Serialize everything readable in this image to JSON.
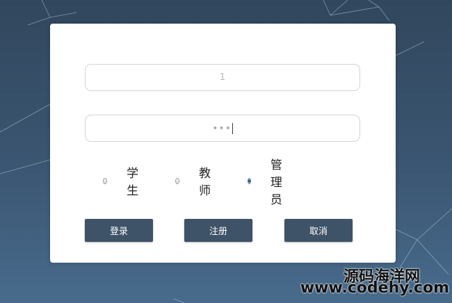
{
  "form": {
    "username_value": "1",
    "password_mask": "•••",
    "roles": [
      {
        "label": "学生",
        "checked": false
      },
      {
        "label": "教师",
        "checked": false
      },
      {
        "label": "管理员",
        "checked": true
      }
    ],
    "buttons": {
      "login": "登录",
      "register": "注册",
      "cancel": "取消"
    }
  },
  "watermark": {
    "name": "源码海洋网",
    "url": "www.codehy.com"
  },
  "colors": {
    "background": "#3b5672",
    "button": "#3e5268",
    "card": "#ffffff"
  }
}
